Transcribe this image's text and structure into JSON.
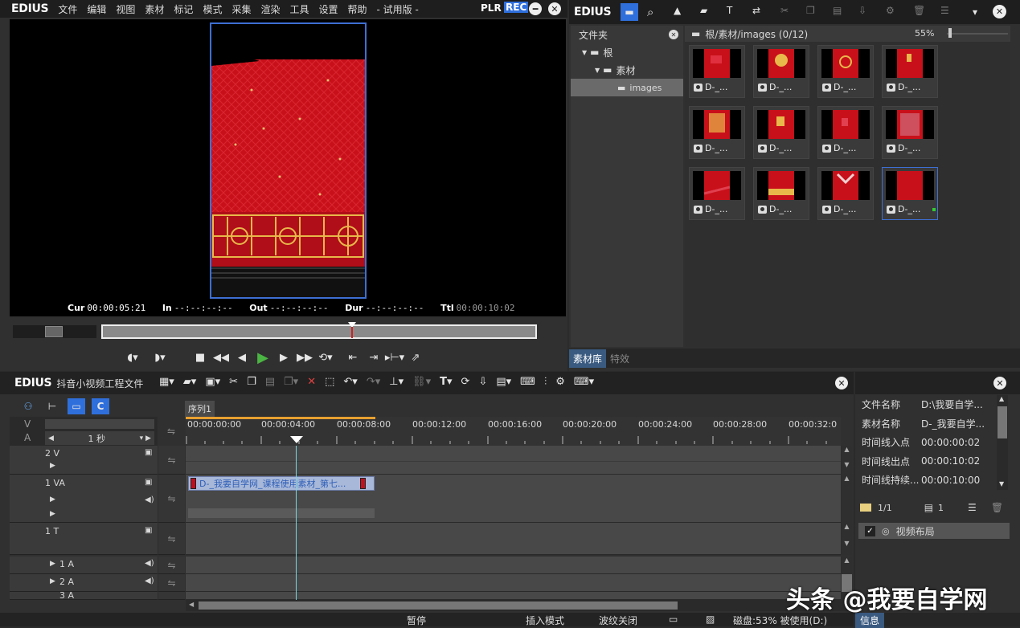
{
  "colors": {
    "accent": "#3d6fd4",
    "rec": "#2f6fdc",
    "red_x": "#e04040",
    "play": "#4bb543"
  },
  "player": {
    "brand": "EDIUS",
    "menu": [
      "文件",
      "编辑",
      "视图",
      "素材",
      "标记",
      "模式",
      "采集",
      "渲染",
      "工具",
      "设置",
      "帮助",
      "- 试用版 -"
    ],
    "plr": "PLR",
    "rec": "REC",
    "cur_label": "Cur",
    "cur": "00:00:05:21",
    "in_label": "In",
    "in": "--:--:--:--",
    "out_label": "Out",
    "out": "--:--:--:--",
    "dur_label": "Dur",
    "dur": "--:--:--:--",
    "ttl_label": "Ttl",
    "ttl": "00:00:10:02"
  },
  "bin": {
    "brand": "EDIUS",
    "folder_header": "文件夹",
    "tree": [
      "根",
      "素材",
      "images"
    ],
    "path": "根/素材/images (0/12)",
    "zoom": "55%",
    "clip_label": "D-_...",
    "tabs": [
      "素材库",
      "特效"
    ]
  },
  "timeline": {
    "brand": "EDIUS",
    "project": "抖音小视频工程文件",
    "sequence_tab": "序列1",
    "scale": "1 秒",
    "v_label": "V",
    "a_label": "A",
    "ruler": [
      "00:00:00:00",
      "00:00:04:00",
      "00:00:08:00",
      "00:00:12:00",
      "00:00:16:00",
      "00:00:20:00",
      "00:00:24:00",
      "00:00:28:00",
      "00:00:32:0"
    ],
    "tracks": [
      "2 V",
      "1 VA",
      "1 T",
      "1 A",
      "2 A",
      "3 A"
    ],
    "clip_name": "D-_我要自学网_课程使用素材_第七..."
  },
  "info": {
    "rows": [
      {
        "k": "文件名称",
        "v": "D:\\我要自学..."
      },
      {
        "k": "素材名称",
        "v": "D-_我要自学..."
      },
      {
        "k": "时间线入点",
        "v": "00:00:00:02"
      },
      {
        "k": "时间线出点",
        "v": "00:00:10:02"
      },
      {
        "k": "时间线持续...",
        "v": "00:00:10:00"
      }
    ],
    "page": "1/1",
    "layer_count": "1",
    "layout_item": "视频布局",
    "tab": "信息"
  },
  "status": {
    "pause": "暂停",
    "insert": "插入模式",
    "ripple": "波纹关闭",
    "disk": "磁盘:53% 被使用(D:)"
  },
  "watermark": "头条 @我要自学网"
}
